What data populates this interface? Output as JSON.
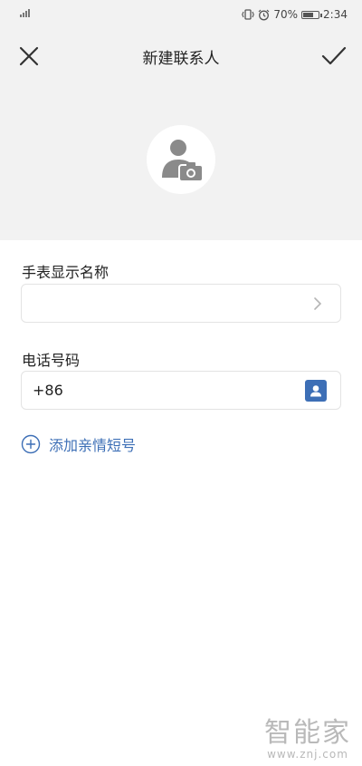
{
  "status_bar": {
    "battery_percent": "70%",
    "battery_level": 0.7,
    "time": "2:34",
    "icons": [
      "signal-icon",
      "vibrate-icon",
      "alarm-icon",
      "battery-icon"
    ]
  },
  "header": {
    "title": "新建联系人",
    "close_icon": "close-icon",
    "confirm_icon": "check-icon"
  },
  "avatar": {
    "icon": "avatar-camera-icon"
  },
  "form": {
    "display_name": {
      "label": "手表显示名称",
      "value": "",
      "placeholder": ""
    },
    "phone": {
      "label": "电话号码",
      "value": "+86",
      "placeholder": ""
    },
    "add_short_number": {
      "label": "添加亲情短号"
    }
  },
  "watermark": {
    "logo": "智能家",
    "url": "www.znj.com"
  },
  "colors": {
    "accent": "#3d6fb6",
    "header_bg": "#f2f2f2",
    "text": "#222222",
    "border": "#e3e3e3"
  }
}
